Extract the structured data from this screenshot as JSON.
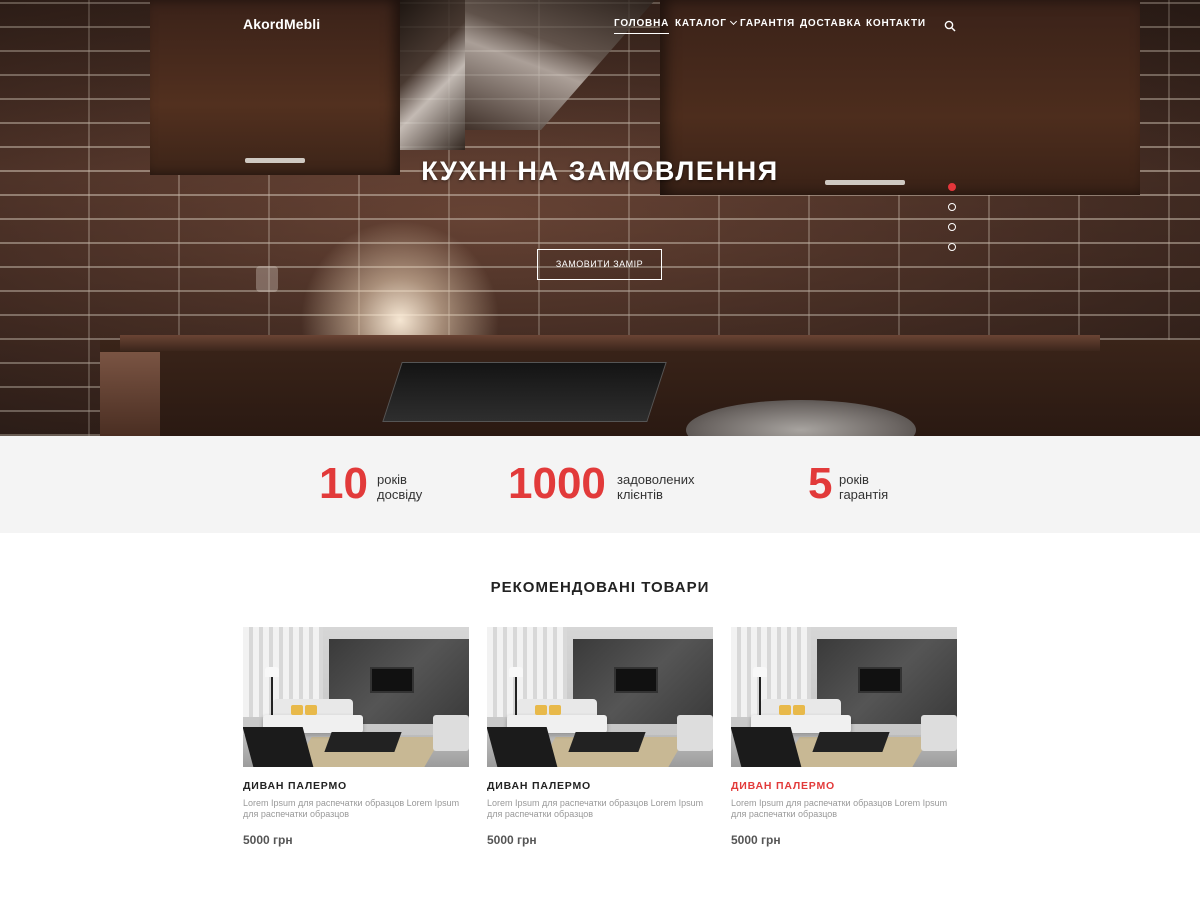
{
  "header": {
    "logo": "AkordMebli",
    "nav": [
      {
        "label": "ГОЛОВНА",
        "active": true
      },
      {
        "label": "КАТАЛОГ",
        "has_dropdown": true
      },
      {
        "label": "ГАРАНТІЯ"
      },
      {
        "label": "ДОСТАВКА"
      },
      {
        "label": "КОНТАКТИ"
      }
    ],
    "search_icon": "search-icon"
  },
  "hero": {
    "title": "КУХНІ НА ЗАМОВЛЕННЯ",
    "button": "ЗАМОВИТИ ЗАМІР",
    "slides_count": 4,
    "active_slide": 1
  },
  "stats": [
    {
      "number": "10",
      "label_line1": "років",
      "label_line2": "досвіду"
    },
    {
      "number": "1000",
      "label_line1": "задоволених",
      "label_line2": "клієнтів"
    },
    {
      "number": "5",
      "label_line1": "років",
      "label_line2": "гарантія"
    }
  ],
  "products": {
    "title": "РЕКОМЕНДОВАНІ ТОВАРИ",
    "items": [
      {
        "name": "ДИВАН ПАЛЕРМО",
        "description": "Lorem Ipsum для распечатки образцов Lorem Ipsum для распечатки образцов",
        "price": "5000 грн",
        "highlighted": false
      },
      {
        "name": "ДИВАН ПАЛЕРМО",
        "description": "Lorem Ipsum для распечатки образцов Lorem Ipsum для распечатки образцов",
        "price": "5000 грн",
        "highlighted": false
      },
      {
        "name": "ДИВАН ПАЛЕРМО",
        "description": "Lorem Ipsum для распечатки образцов Lorem Ipsum для распечатки образцов",
        "price": "5000 грн",
        "highlighted": true
      }
    ]
  },
  "colors": {
    "accent": "#e23a3a",
    "stats_bg": "#f4f4f4",
    "text_muted": "#999999"
  }
}
